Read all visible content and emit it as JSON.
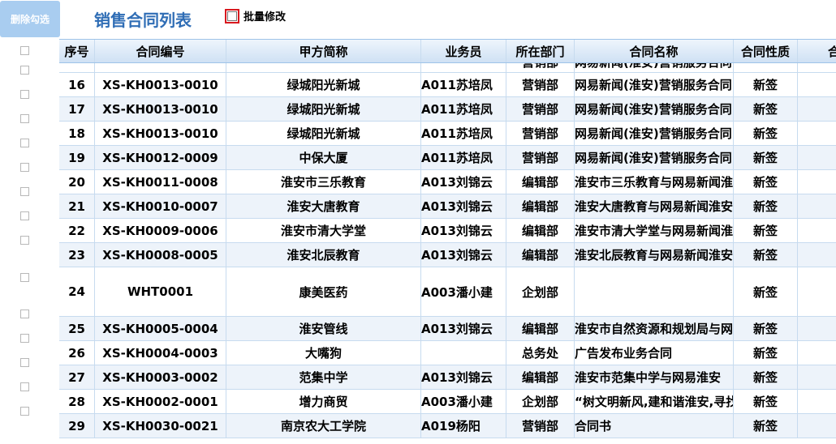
{
  "toolbar": {
    "delete_label": "删除勾选",
    "title": "销售合同列表",
    "batch_label": "批量修改"
  },
  "table": {
    "headers": [
      "序号",
      "合同编号",
      "甲方简称",
      "业务员",
      "所在部门",
      "合同名称",
      "合同性质",
      "合"
    ],
    "partial_row": [
      "",
      "",
      "",
      "",
      "营销部",
      "网易新闻(淮安)营销服务合同",
      ""
    ],
    "rows": [
      {
        "no": "16",
        "code": "XS-KH0013-0010",
        "party": "绿城阳光新城",
        "staff": "A011苏培凤",
        "dept": "营销部",
        "name": "网易新闻(淮安)营销服务合同",
        "nature": "新签"
      },
      {
        "no": "17",
        "code": "XS-KH0013-0010",
        "party": "绿城阳光新城",
        "staff": "A011苏培凤",
        "dept": "营销部",
        "name": "网易新闻(淮安)营销服务合同",
        "nature": "新签"
      },
      {
        "no": "18",
        "code": "XS-KH0013-0010",
        "party": "绿城阳光新城",
        "staff": "A011苏培凤",
        "dept": "营销部",
        "name": "网易新闻(淮安)营销服务合同",
        "nature": "新签"
      },
      {
        "no": "19",
        "code": "XS-KH0012-0009",
        "party": "中保大厦",
        "staff": "A011苏培凤",
        "dept": "营销部",
        "name": "网易新闻(淮安)营销服务合同",
        "nature": "新签"
      },
      {
        "no": "20",
        "code": "XS-KH0011-0008",
        "party": "淮安市三乐教育",
        "staff": "A013刘锦云",
        "dept": "编辑部",
        "name": "淮安市三乐教育与网易新闻淮安",
        "nature": "新签"
      },
      {
        "no": "21",
        "code": "XS-KH0010-0007",
        "party": "淮安大唐教育",
        "staff": "A013刘锦云",
        "dept": "编辑部",
        "name": "淮安大唐教育与网易新闻淮安",
        "nature": "新签"
      },
      {
        "no": "22",
        "code": "XS-KH0009-0006",
        "party": "淮安市清大学堂",
        "staff": "A013刘锦云",
        "dept": "编辑部",
        "name": "淮安市清大学堂与网易新闻淮安",
        "nature": "新签"
      },
      {
        "no": "23",
        "code": "XS-KH0008-0005",
        "party": "淮安北辰教育",
        "staff": "A013刘锦云",
        "dept": "编辑部",
        "name": "淮安北辰教育与网易新闻淮安",
        "nature": "新签"
      },
      {
        "no": "24",
        "code": "WHT0001",
        "party": "康美医药",
        "staff": "A003潘小建",
        "dept": "企划部",
        "name": "",
        "nature": "新签"
      },
      {
        "no": "25",
        "code": "XS-KH0005-0004",
        "party": "淮安管线",
        "staff": "A013刘锦云",
        "dept": "编辑部",
        "name": "淮安市自然资源和规划局与网易",
        "nature": "新签"
      },
      {
        "no": "26",
        "code": "XS-KH0004-0003",
        "party": "大嘴狗",
        "staff": "",
        "dept": "总务处",
        "name": "广告发布业务合同",
        "nature": "新签"
      },
      {
        "no": "27",
        "code": "XS-KH0003-0002",
        "party": "范集中学",
        "staff": "A013刘锦云",
        "dept": "编辑部",
        "name": "淮安市范集中学与网易淮安",
        "nature": "新签"
      },
      {
        "no": "28",
        "code": "XS-KH0002-0001",
        "party": "增力商贸",
        "staff": "A003潘小建",
        "dept": "企划部",
        "name": "“树文明新风,建和谐淮安,寻找",
        "nature": "新签"
      },
      {
        "no": "29",
        "code": "XS-KH0030-0021",
        "party": "南京农大工学院",
        "staff": "A019杨阳",
        "dept": "营销部",
        "name": "合同书",
        "nature": "新签"
      }
    ]
  }
}
